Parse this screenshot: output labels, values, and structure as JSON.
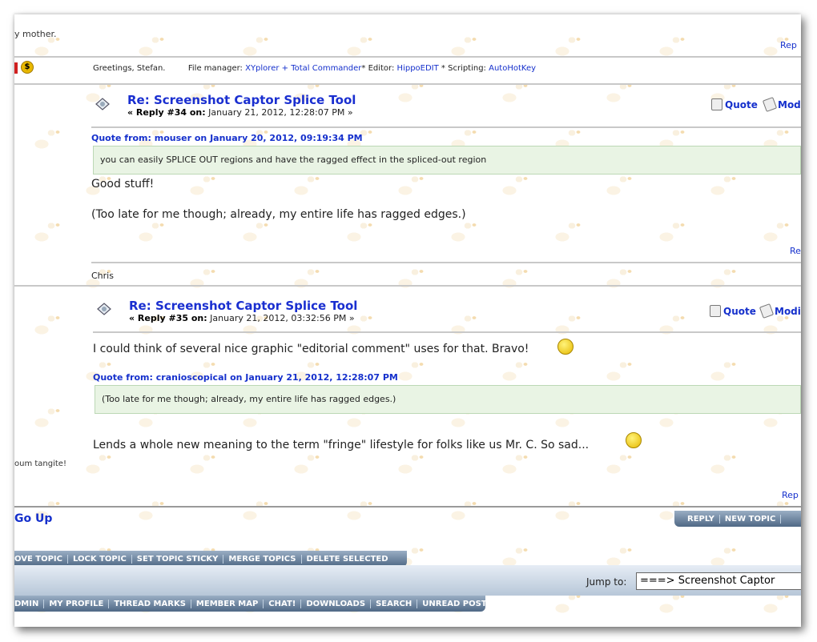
{
  "top": {
    "fragment": "y mother.",
    "reply_fragment": "Rep"
  },
  "signature_row": {
    "greeting": "Greetings, Stefan.",
    "fm_label": "File manager: ",
    "fm_value": "XYplorer + Total Commander",
    "editor_label": "* Editor: ",
    "editor_value": "HippoEDIT",
    "scripting_label": " * Scripting: ",
    "scripting_value": "AutoHotKey"
  },
  "post34": {
    "title": "Re: Screenshot Captor Splice Tool",
    "reply_label": "« Reply #34 on:",
    "date": "January 21, 2012, 12:28:07 PM »",
    "quote_btn": "Quote",
    "modify_btn": "Mod",
    "quote_header": "Quote from: mouser on January 20, 2012, 09:19:34 PM",
    "quote_text": "you can easily SPLICE OUT regions and have the ragged effect in the spliced-out region",
    "line1": "Good stuff!",
    "line2": "(Too late for me though; already, my entire life has ragged edges.)",
    "reply_fragment": "Re",
    "signature": "Chris"
  },
  "post35": {
    "title": "Re: Screenshot Captor Splice Tool",
    "reply_label": "« Reply #35 on:",
    "date": "January 21, 2012, 03:32:56 PM »",
    "quote_btn": "Quote",
    "modify_btn": "Modi",
    "line1": "I could think of several nice graphic \"editorial comment\" uses for that. Bravo!",
    "quote_header": "Quote from: cranioscopical on January 21, 2012, 12:28:07 PM",
    "quote_text": "(Too late for me though; already, my entire life has ragged edges.)",
    "line2": "Lends a whole new meaning to the term \"fringe\" lifestyle for folks like us Mr. C. So sad...",
    "left_fragment": "oum tangite!",
    "reply_fragment": "Rep"
  },
  "footer": {
    "go_up": "Go Up",
    "reply_tabs": [
      "REPLY",
      "NEW TOPIC",
      ""
    ],
    "mod_tabs": [
      "OVE TOPIC",
      "LOCK TOPIC",
      "SET TOPIC STICKY",
      "MERGE TOPICS",
      "DELETE SELECTED"
    ],
    "jump_label": "Jump to:",
    "jump_value": "===> Screenshot Captor",
    "nav_tabs": [
      "DMIN",
      "MY PROFILE",
      "THREAD MARKS",
      "MEMBER MAP",
      "CHAT!",
      "DOWNLOADS",
      "SEARCH",
      "UNREAD POSTS"
    ]
  }
}
